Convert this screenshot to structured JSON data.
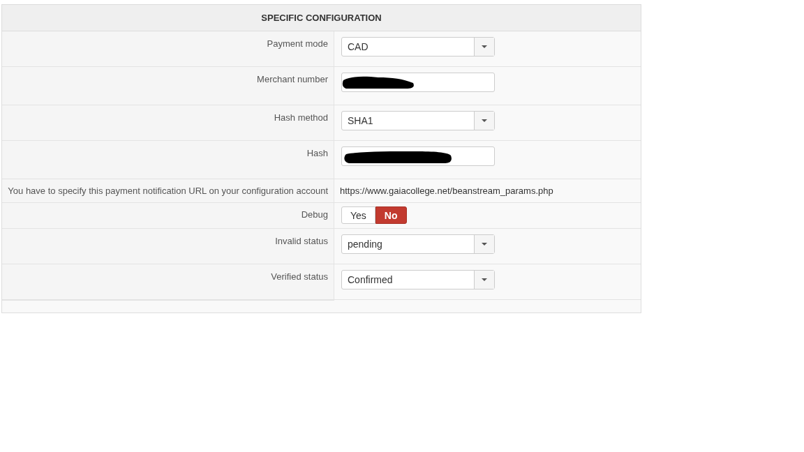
{
  "panel": {
    "title": "SPECIFIC CONFIGURATION"
  },
  "rows": [
    {
      "kind": "select",
      "label": "Payment mode",
      "value": "CAD"
    },
    {
      "kind": "text",
      "label": "Merchant number",
      "redacted": true
    },
    {
      "kind": "select",
      "label": "Hash method",
      "value": "SHA1"
    },
    {
      "kind": "text",
      "label": "Hash",
      "redacted": true
    },
    {
      "kind": "static",
      "label": "You have to specify this payment notification URL on your configuration account",
      "value": "https://www.gaiacollege.net/beanstream_params.php"
    },
    {
      "kind": "toggle",
      "label": "Debug",
      "options": [
        {
          "label": "Yes",
          "selected": false
        },
        {
          "label": "No",
          "selected": true
        }
      ]
    },
    {
      "kind": "select",
      "label": "Invalid status",
      "value": "pending"
    },
    {
      "kind": "select",
      "label": "Verified status",
      "value": "Confirmed"
    }
  ]
}
